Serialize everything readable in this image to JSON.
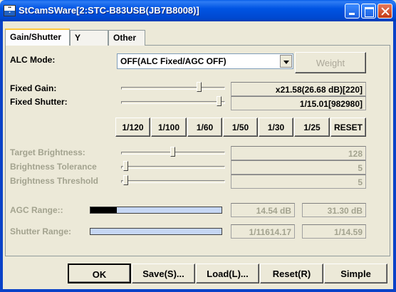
{
  "window": {
    "title": "StCamSWare[2:STC-B83USB(JB7B8008)]"
  },
  "tabs": [
    {
      "label": "Gain/Shutter"
    },
    {
      "label": "Y"
    },
    {
      "label": "Other"
    }
  ],
  "alc": {
    "label": "ALC Mode:",
    "selected": "OFF(ALC Fixed/AGC OFF)",
    "weight_button": "Weight"
  },
  "fixed_gain": {
    "label": "Fixed Gain:",
    "value": "x21.58(26.68 dB)[220]",
    "level": 0.77
  },
  "fixed_shutter": {
    "label": "Fixed Shutter:",
    "value": "1/15.01[982980]",
    "level": 0.97
  },
  "shutter_presets": [
    "1/120",
    "1/100",
    "1/60",
    "1/50",
    "1/30",
    "1/25",
    "RESET"
  ],
  "target_brightness": {
    "label": "Target Brightness:",
    "value": "128",
    "level": 0.5
  },
  "brightness_tolerance": {
    "label": "Brightness Tolerance",
    "value": "5",
    "level": 0.02
  },
  "brightness_threshold": {
    "label": "Brightness Threshold",
    "value": "5",
    "level": 0.02
  },
  "agc_range": {
    "label": "AGC Range::",
    "min": "14.54 dB",
    "max": "31.30 dB",
    "fill": 0.2
  },
  "shutter_range": {
    "label": "Shutter Range:",
    "min": "1/11614.17",
    "max": "1/14.59",
    "fill": 0
  },
  "footer": {
    "ok": "OK",
    "save": "Save(S)...",
    "load": "Load(L)...",
    "reset": "Reset(R)",
    "simple": "Simple"
  },
  "colors": {
    "titlebar": "#0054E3",
    "face": "#ECE9D8",
    "tab_highlight": "#FFC83C"
  }
}
